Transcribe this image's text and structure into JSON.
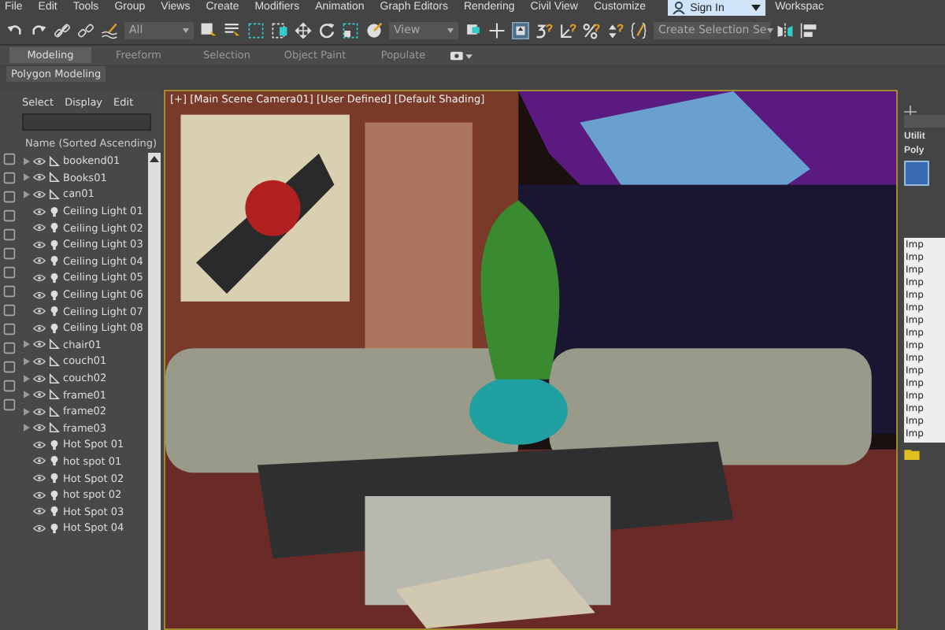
{
  "menu_bar": [
    "File",
    "Edit",
    "Tools",
    "Group",
    "Views",
    "Create",
    "Modifiers",
    "Animation",
    "Graph Editors",
    "Rendering",
    "Civil View",
    "Customize"
  ],
  "sign_in": {
    "label": "Sign In"
  },
  "workspace": {
    "label": "Workspac"
  },
  "toolbar": {
    "filter": "All",
    "reference": "View",
    "selection_set": "Create Selection Se"
  },
  "ribbon_tabs": [
    {
      "label": "Modeling",
      "selected": true
    },
    {
      "label": "Freeform",
      "selected": false
    },
    {
      "label": "Selection",
      "selected": false
    },
    {
      "label": "Object Paint",
      "selected": false
    },
    {
      "label": "Populate",
      "selected": false
    }
  ],
  "ribbon_panel": "Polygon Modeling",
  "scene_explorer": {
    "menu": [
      "Select",
      "Display",
      "Edit"
    ],
    "column": "Name (Sorted Ascending)",
    "items": [
      {
        "name": "bookend01",
        "kind": "geometry"
      },
      {
        "name": "Books01",
        "kind": "geometry"
      },
      {
        "name": "can01",
        "kind": "geometry"
      },
      {
        "name": "Ceiling Light 01",
        "kind": "light"
      },
      {
        "name": "Ceiling Light 02",
        "kind": "light"
      },
      {
        "name": "Ceiling Light 03",
        "kind": "light"
      },
      {
        "name": "Ceiling Light 04",
        "kind": "light"
      },
      {
        "name": "Ceiling Light 05",
        "kind": "light"
      },
      {
        "name": "Ceiling Light 06",
        "kind": "light"
      },
      {
        "name": "Ceiling Light 07",
        "kind": "light"
      },
      {
        "name": "Ceiling Light 08",
        "kind": "light"
      },
      {
        "name": "chair01",
        "kind": "geometry"
      },
      {
        "name": "couch01",
        "kind": "geometry"
      },
      {
        "name": "couch02",
        "kind": "geometry"
      },
      {
        "name": "frame01",
        "kind": "geometry"
      },
      {
        "name": "frame02",
        "kind": "geometry"
      },
      {
        "name": "frame03",
        "kind": "geometry"
      },
      {
        "name": "Hot Spot 01",
        "kind": "light"
      },
      {
        "name": "hot spot 01",
        "kind": "light"
      },
      {
        "name": "Hot Spot 02",
        "kind": "light"
      },
      {
        "name": "hot spot 02",
        "kind": "light"
      },
      {
        "name": "Hot Spot 03",
        "kind": "light"
      },
      {
        "name": "Hot Spot 04",
        "kind": "light"
      }
    ]
  },
  "viewport": {
    "label": "[+] [Main Scene Camera01] [User Defined] [Default Shading]"
  },
  "command_panel": {
    "rollouts": [
      "Utilit",
      "Poly"
    ],
    "list": [
      "Imp",
      "Imp",
      "Imp",
      "Imp",
      "Imp",
      "Imp",
      "Imp",
      "Imp",
      "Imp",
      "Imp",
      "Imp",
      "Imp",
      "Imp",
      "Imp",
      "Imp",
      "Imp"
    ]
  }
}
